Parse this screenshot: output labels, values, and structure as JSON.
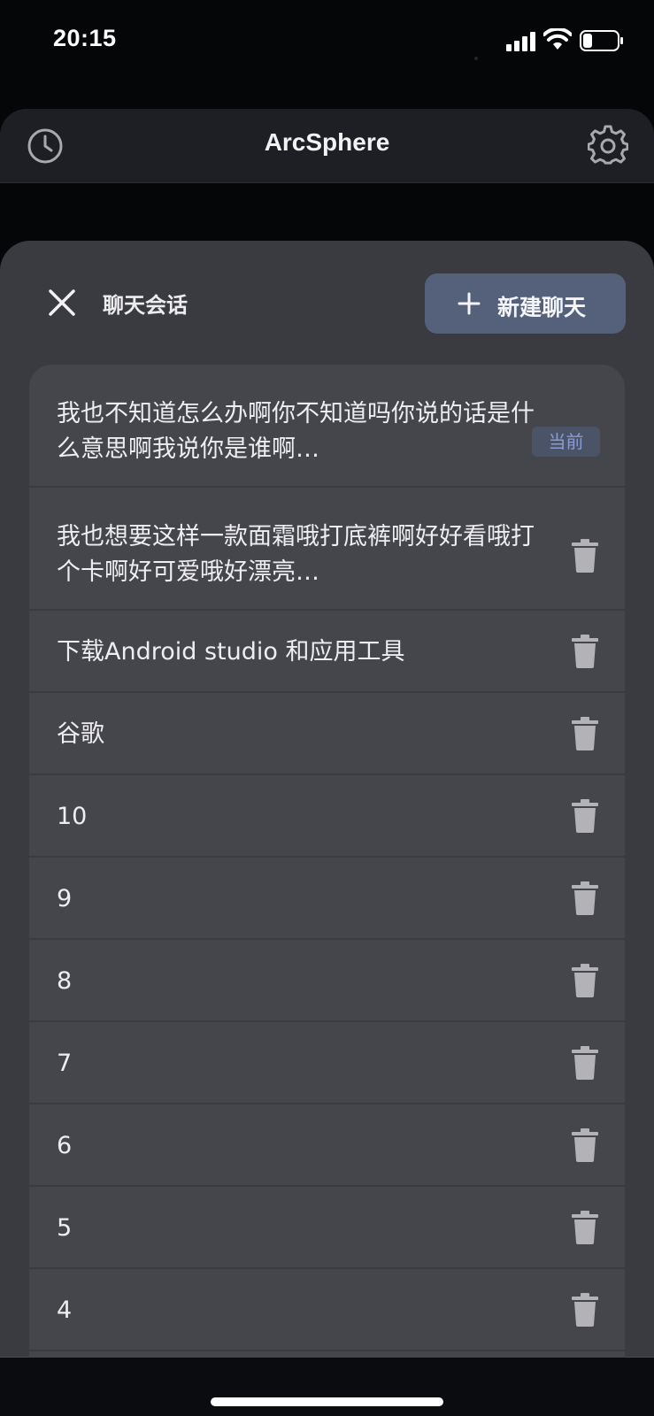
{
  "status_bar": {
    "time": "20:15"
  },
  "header": {
    "title": "ArcSphere",
    "icons": {
      "left": "history-icon",
      "right": "settings-icon"
    }
  },
  "sheet": {
    "title": "聊天会话",
    "new_chat_label": "新建聊天",
    "current_badge": "当前",
    "items": [
      {
        "text": "我也不知道怎么办啊你不知道吗你说的话是什么意思啊我说你是谁啊…",
        "current": true
      },
      {
        "text": "我也想要这样一款面霜哦打底裤啊好好看哦打个卡啊好可爱哦好漂亮…",
        "current": false
      },
      {
        "text": "下载Android studio 和应用工具",
        "current": false
      },
      {
        "text": "谷歌",
        "current": false
      },
      {
        "text": "10",
        "current": false
      },
      {
        "text": "9",
        "current": false
      },
      {
        "text": "8",
        "current": false
      },
      {
        "text": "7",
        "current": false
      },
      {
        "text": "6",
        "current": false
      },
      {
        "text": "5",
        "current": false
      },
      {
        "text": "4",
        "current": false
      }
    ]
  },
  "colors": {
    "background": "#050608",
    "header": "#1E1F24",
    "sheet": "#3A3B40",
    "list": "#45464C",
    "accent_button": "#55607A",
    "badge_text": "#8C9BD6"
  }
}
